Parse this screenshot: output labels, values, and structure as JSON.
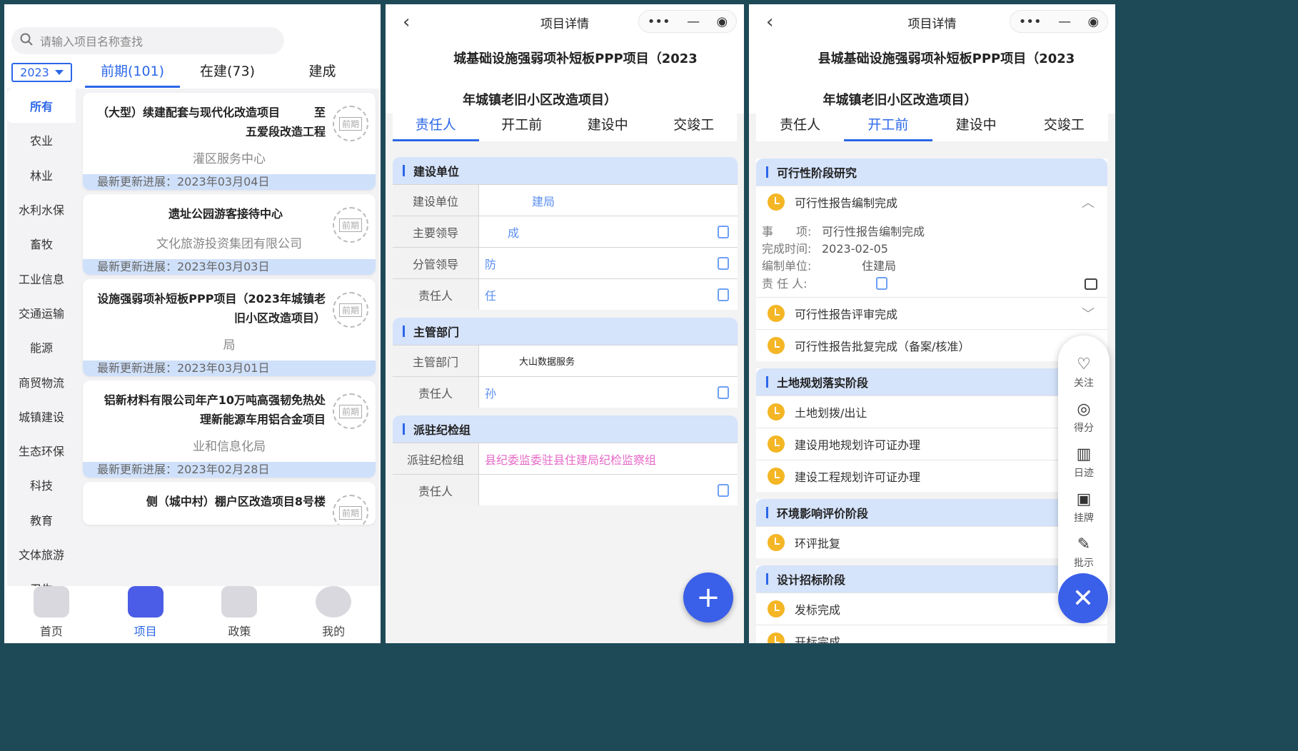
{
  "panel1": {
    "search_placeholder": "请输入项目名称查找",
    "year": "2023",
    "tabs": [
      "前期(101)",
      "在建(73)",
      "建成"
    ],
    "categories": [
      "所有",
      "农业",
      "林业",
      "水利水保",
      "畜牧",
      "工业信息",
      "交通运输",
      "能源",
      "商贸物流",
      "城镇建设",
      "生态环保",
      "科技",
      "教育",
      "文体旅游",
      "卫生"
    ],
    "cards": [
      {
        "title": "（大型）续建配套与现代化改造项目　　　至五爱段改造工程",
        "org": "灌区服务中心",
        "update": "最新更新进展：2023年03月04日",
        "stamp": "前期"
      },
      {
        "title": "遗址公园游客接待中心",
        "org": "文化旅游投资集团有限公司",
        "update": "最新更新进展：2023年03月03日",
        "stamp": "前期"
      },
      {
        "title": "设施强弱项补短板PPP项目（2023年城镇老旧小区改造项目）",
        "org": "局",
        "update": "最新更新进展：2023年03月01日",
        "stamp": "前期"
      },
      {
        "title": "铝新材料有限公司年产10万吨高强韧免热处理新能源车用铝合金项目",
        "org": "业和信息化局",
        "update": "最新更新进展：2023年02月28日",
        "stamp": "前期"
      },
      {
        "title": "侧（城中村）棚户区改造项目8号楼",
        "org": "",
        "update": "",
        "stamp": "前期"
      }
    ],
    "nav": [
      "首页",
      "项目",
      "政策",
      "我的"
    ]
  },
  "panel2": {
    "header": "项目详情",
    "capsule": {
      "more": "•••",
      "min": "—",
      "rec": "◉"
    },
    "title_line1": "城基础设施强弱项补短板PPP项目（2023",
    "title_line2": "年城镇老旧小区改造项目）",
    "tabs": [
      "责任人",
      "开工前",
      "建设中",
      "交竣工"
    ],
    "sections": [
      {
        "name": "建设单位",
        "rows": [
          [
            "建设单位",
            "建局",
            false
          ],
          [
            "主要领导",
            "成",
            true
          ],
          [
            "分管领导",
            "防",
            true
          ],
          [
            "责任人",
            "任",
            true
          ]
        ]
      },
      {
        "name": "主管部门",
        "rows": [
          [
            "主管部门",
            "大山数据服务",
            false
          ],
          [
            "责任人",
            "孙",
            true
          ]
        ]
      },
      {
        "name": "派驻纪检组",
        "rows": [
          [
            "派驻纪检组",
            "县纪委监委驻县住建局纪检监察组",
            false
          ],
          [
            "责任人",
            "",
            true
          ]
        ]
      }
    ],
    "fab": "+"
  },
  "panel3": {
    "header": "项目详情",
    "title_line1": "县城基础设施强弱项补短板PPP项目（2023",
    "title_line2": "年城镇老旧小区改造项目）",
    "tabs": [
      "责任人",
      "开工前",
      "建设中",
      "交竣工"
    ],
    "stages": [
      {
        "name": "可行性阶段研究",
        "items": [
          "可行性报告编制完成",
          "可行性报告评审完成",
          "可行性报告批复完成（备案/核准）"
        ]
      },
      {
        "name": "土地规划落实阶段",
        "items": [
          "土地划拨/出让",
          "建设用地规划许可证办理",
          "建设工程规划许可证办理"
        ]
      },
      {
        "name": "环境影响评价阶段",
        "items": [
          "环评批复"
        ]
      },
      {
        "name": "设计招标阶段",
        "items": [
          "发标完成",
          "开标完成"
        ]
      }
    ],
    "detail": {
      "matter_label": "事　　项:",
      "matter": "可行性报告编制完成",
      "date_label": "完成时间:",
      "date": "2023-02-05",
      "unit_label": "编制单位:",
      "unit": "住建局",
      "person_label": "责 任 人:"
    },
    "float_menu": [
      "关注",
      "得分",
      "日迹",
      "挂牌",
      "批示"
    ],
    "close": "✕"
  }
}
